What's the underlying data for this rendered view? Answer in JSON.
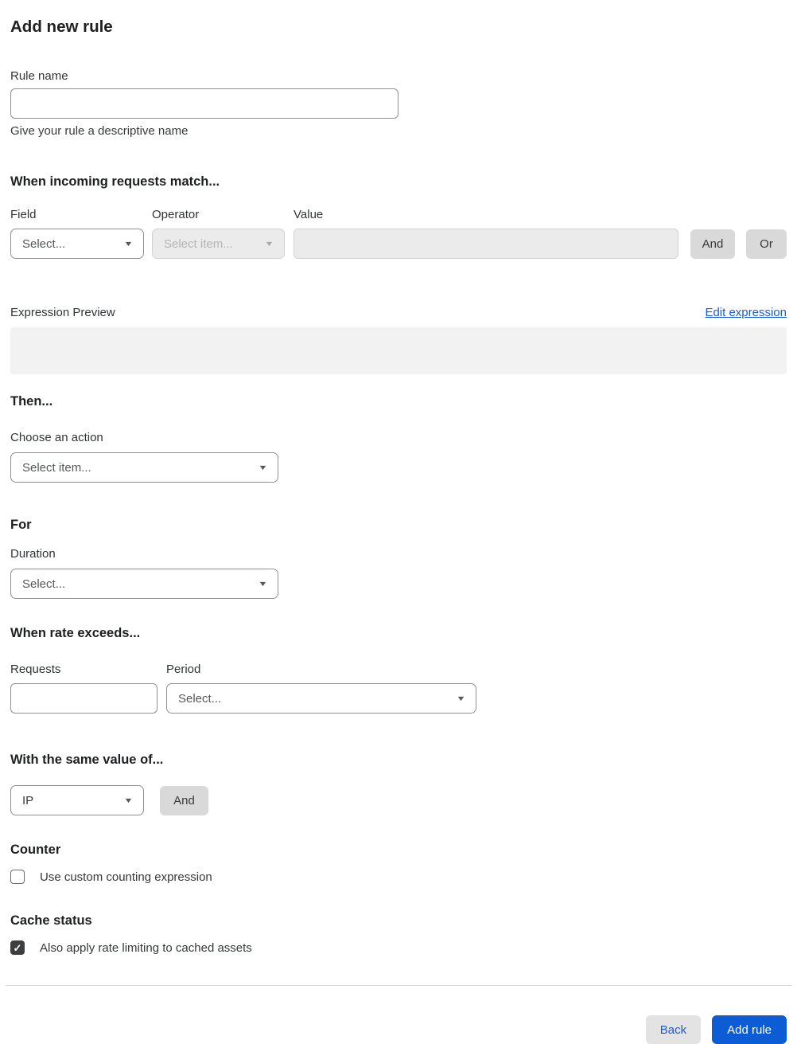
{
  "page": {
    "title": "Add new rule"
  },
  "icons": {
    "caret_down": "▼",
    "check": "✓"
  },
  "rule_name": {
    "label": "Rule name",
    "value": "",
    "help": "Give your rule a descriptive name"
  },
  "match": {
    "heading": "When incoming requests match...",
    "field": {
      "label": "Field",
      "placeholder": "Select..."
    },
    "operator": {
      "label": "Operator",
      "placeholder": "Select item..."
    },
    "value": {
      "label": "Value",
      "value": ""
    },
    "and_label": "And",
    "or_label": "Or"
  },
  "expression": {
    "label": "Expression Preview",
    "edit_link": "Edit expression",
    "preview": ""
  },
  "then": {
    "heading": "Then...",
    "action_label": "Choose an action",
    "action_placeholder": "Select item..."
  },
  "for_section": {
    "heading": "For",
    "duration_label": "Duration",
    "duration_placeholder": "Select..."
  },
  "rate": {
    "heading": "When rate exceeds...",
    "requests_label": "Requests",
    "requests_value": "",
    "period_label": "Period",
    "period_placeholder": "Select..."
  },
  "same_value": {
    "heading": "With the same value of...",
    "selected": "IP",
    "and_label": "And"
  },
  "counter": {
    "heading": "Counter",
    "checkbox_label": "Use custom counting expression",
    "checked": "false"
  },
  "cache": {
    "heading": "Cache status",
    "checkbox_label": "Also apply rate limiting to cached assets",
    "checked": "true"
  },
  "footer": {
    "back_label": "Back",
    "submit_label": "Add rule"
  },
  "colors": {
    "accent_blue": "#0b5cd5",
    "link_blue": "#1a5cd8",
    "button_gray": "#d9d9d9",
    "preview_gray": "#f2f2f2",
    "checkbox_dark": "#3c3f40"
  }
}
